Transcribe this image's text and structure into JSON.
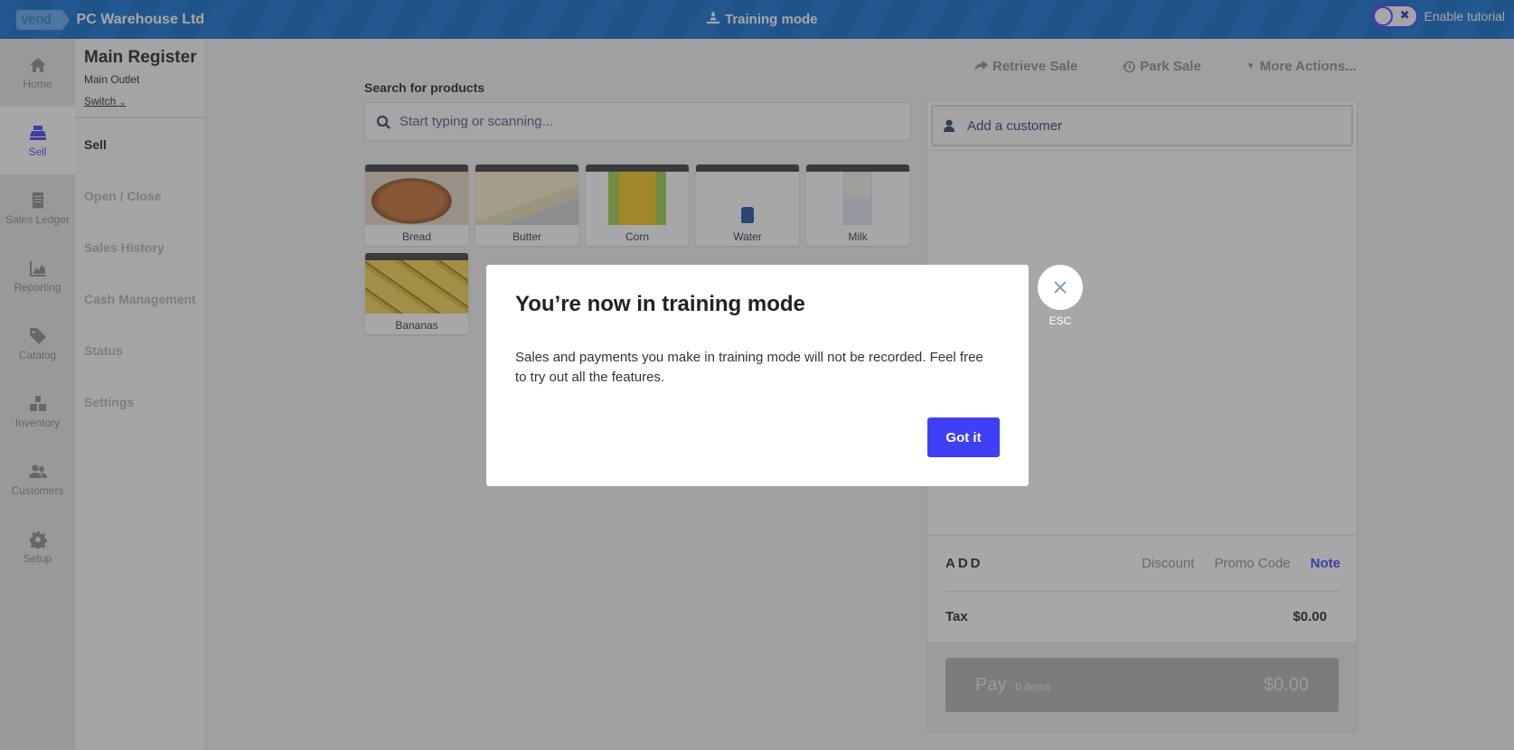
{
  "header": {
    "logo_text": "vend",
    "store_name": "PC Warehouse Ltd",
    "mode_label": "Training mode",
    "mode_icon": "traffic-cone-icon",
    "tutorial_label": "Enable tutorial",
    "tutorial_enabled": false
  },
  "nav": {
    "items": [
      {
        "label": "Home",
        "icon": "home-icon",
        "active": false
      },
      {
        "label": "Sell",
        "icon": "register-icon",
        "active": true
      },
      {
        "label": "Sales Ledger",
        "icon": "receipt-icon",
        "active": false
      },
      {
        "label": "Reporting",
        "icon": "chart-icon",
        "active": false
      },
      {
        "label": "Catalog",
        "icon": "tag-icon",
        "active": false
      },
      {
        "label": "Inventory",
        "icon": "boxes-icon",
        "active": false
      },
      {
        "label": "Customers",
        "icon": "users-icon",
        "active": false
      },
      {
        "label": "Setup",
        "icon": "gear-icon",
        "active": false
      }
    ]
  },
  "register": {
    "title": "Main Register",
    "outlet": "Main Outlet",
    "switch_label": "Switch",
    "menu": [
      {
        "label": "Sell",
        "active": true
      },
      {
        "label": "Open / Close",
        "active": false
      },
      {
        "label": "Sales History",
        "active": false
      },
      {
        "label": "Cash Management",
        "active": false
      },
      {
        "label": "Status",
        "active": false
      },
      {
        "label": "Settings",
        "active": false
      }
    ]
  },
  "search": {
    "label": "Search for products",
    "placeholder": "Start typing or scanning...",
    "value": ""
  },
  "products": [
    {
      "name": "Bread"
    },
    {
      "name": "Butter"
    },
    {
      "name": "Corn"
    },
    {
      "name": "Water"
    },
    {
      "name": "Milk"
    },
    {
      "name": "Bananas"
    }
  ],
  "actions": {
    "retrieve": "Retrieve Sale",
    "park": "Park Sale",
    "more": "More Actions..."
  },
  "sale": {
    "customer_placeholder": "Add a customer",
    "add_label": "ADD",
    "discount": "Discount",
    "promo": "Promo Code",
    "note": "Note",
    "tax_label": "Tax",
    "tax_value": "$0.00",
    "pay_label": "Pay",
    "pay_items": "0 items",
    "pay_total": "$0.00"
  },
  "modal": {
    "title": "You’re now in training mode",
    "body": "Sales and payments you make in training mode will not be recorded. Feel free to try out all the features.",
    "confirm": "Got it",
    "close_hint": "ESC"
  },
  "colors": {
    "brand_blue": "#0a66c2",
    "accent": "#3f3ff5"
  }
}
